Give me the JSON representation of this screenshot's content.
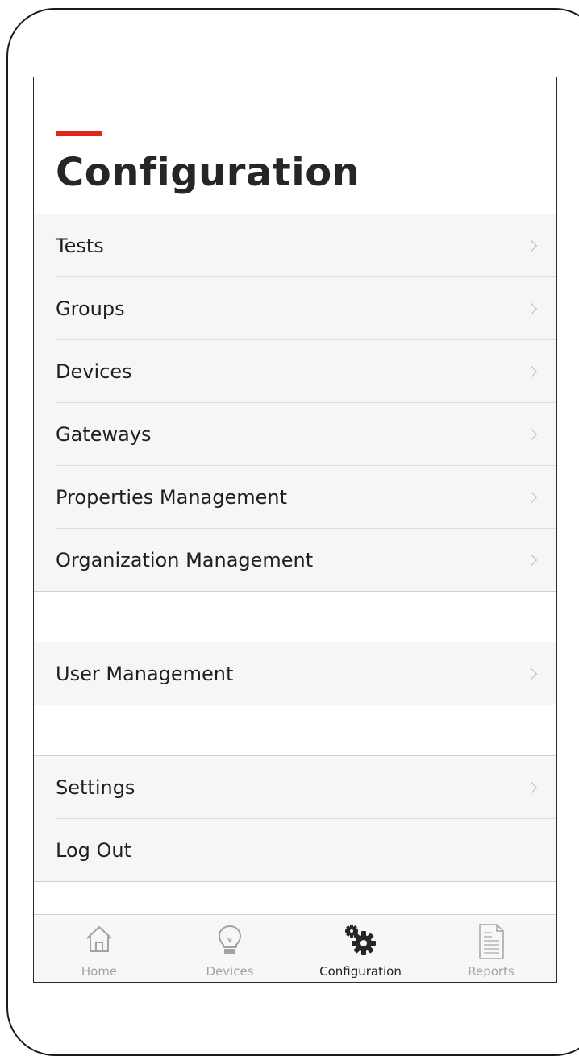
{
  "header": {
    "title": "Configuration"
  },
  "menu": {
    "group1": [
      {
        "label": "Tests",
        "has_chevron": true
      },
      {
        "label": "Groups",
        "has_chevron": true
      },
      {
        "label": "Devices",
        "has_chevron": true
      },
      {
        "label": "Gateways",
        "has_chevron": true
      },
      {
        "label": "Properties Management",
        "has_chevron": true
      },
      {
        "label": "Organization Management",
        "has_chevron": true
      }
    ],
    "group2": [
      {
        "label": "User Management",
        "has_chevron": true
      }
    ],
    "group3": [
      {
        "label": "Settings",
        "has_chevron": true
      },
      {
        "label": "Log Out",
        "has_chevron": false
      }
    ]
  },
  "tabbar": {
    "tabs": [
      {
        "label": "Home",
        "icon": "home-icon",
        "active": false
      },
      {
        "label": "Devices",
        "icon": "lightbulb-icon",
        "active": false
      },
      {
        "label": "Configuration",
        "icon": "gears-icon",
        "active": true
      },
      {
        "label": "Reports",
        "icon": "document-icon",
        "active": false
      }
    ]
  },
  "colors": {
    "accent": "#e1251b",
    "text": "#1f1f1f",
    "inactive": "#a3a3a3",
    "active_icon": "#262626"
  }
}
